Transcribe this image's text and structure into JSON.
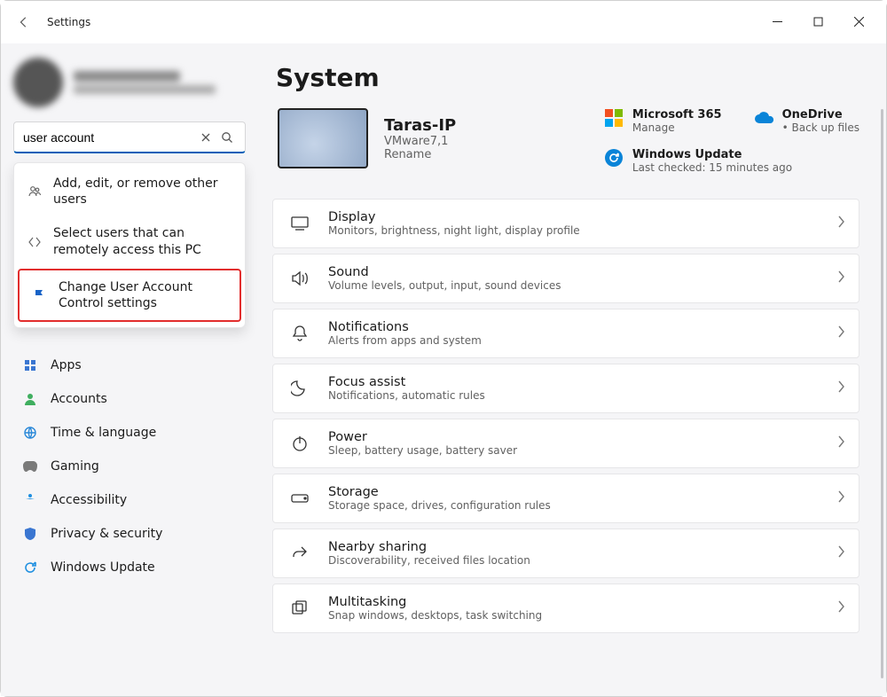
{
  "app": {
    "title": "Settings"
  },
  "search": {
    "value": "user account"
  },
  "suggestions": [
    {
      "icon": "people-icon",
      "label": "Add, edit, or remove other users"
    },
    {
      "icon": "remote-icon",
      "label": "Select users that can remotely access this PC"
    },
    {
      "icon": "flag-icon",
      "label": "Change User Account Control settings",
      "highlight": true
    }
  ],
  "nav": [
    {
      "icon": "apps-icon",
      "label": "Apps"
    },
    {
      "icon": "accounts-icon",
      "label": "Accounts"
    },
    {
      "icon": "time-icon",
      "label": "Time & language"
    },
    {
      "icon": "gaming-icon",
      "label": "Gaming"
    },
    {
      "icon": "a11y-icon",
      "label": "Accessibility"
    },
    {
      "icon": "privacy-icon",
      "label": "Privacy & security"
    },
    {
      "icon": "update-icon",
      "label": "Windows Update"
    }
  ],
  "page": {
    "title": "System"
  },
  "device": {
    "name": "Taras-IP",
    "model": "VMware7,1",
    "rename": "Rename"
  },
  "quick": {
    "m365": {
      "title": "Microsoft 365",
      "sub": "Manage"
    },
    "onedrive": {
      "title": "OneDrive",
      "sub": "Back up files"
    },
    "update": {
      "title": "Windows Update",
      "sub": "Last checked: 15 minutes ago"
    }
  },
  "cards": [
    {
      "icon": "display-icon",
      "title": "Display",
      "sub": "Monitors, brightness, night light, display profile"
    },
    {
      "icon": "sound-icon",
      "title": "Sound",
      "sub": "Volume levels, output, input, sound devices"
    },
    {
      "icon": "bell-icon",
      "title": "Notifications",
      "sub": "Alerts from apps and system"
    },
    {
      "icon": "moon-icon",
      "title": "Focus assist",
      "sub": "Notifications, automatic rules"
    },
    {
      "icon": "power-icon",
      "title": "Power",
      "sub": "Sleep, battery usage, battery saver"
    },
    {
      "icon": "storage-icon",
      "title": "Storage",
      "sub": "Storage space, drives, configuration rules"
    },
    {
      "icon": "share-icon",
      "title": "Nearby sharing",
      "sub": "Discoverability, received files location"
    },
    {
      "icon": "multi-icon",
      "title": "Multitasking",
      "sub": "Snap windows, desktops, task switching"
    }
  ]
}
